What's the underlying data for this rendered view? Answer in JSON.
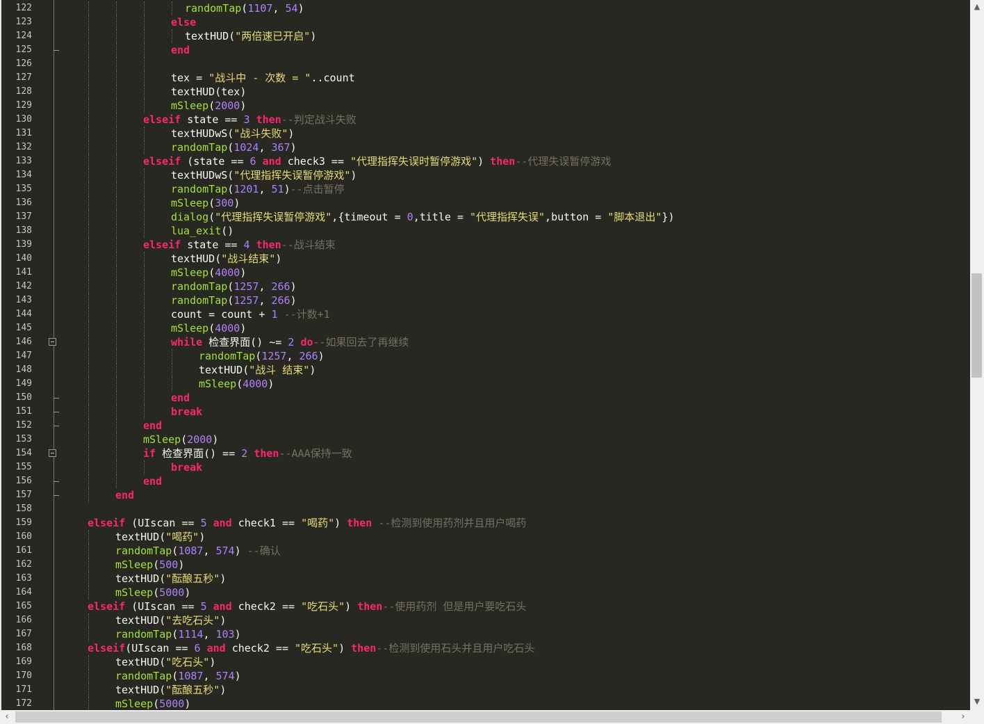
{
  "editor": {
    "first_line_number": 122,
    "lines": [
      [
        [
          9,
          "fn",
          "randomTap"
        ],
        [
          0,
          "op",
          "("
        ],
        [
          0,
          "num",
          "1107"
        ],
        [
          0,
          "op",
          ", "
        ],
        [
          0,
          "num",
          "54"
        ],
        [
          0,
          "op",
          ")"
        ]
      ],
      [
        [
          8,
          "kw",
          "else"
        ]
      ],
      [
        [
          9,
          "op",
          "textHUD("
        ],
        [
          0,
          "str",
          "\"两倍速已开启\""
        ],
        [
          0,
          "op",
          ")"
        ]
      ],
      [
        [
          8,
          "kw",
          "end"
        ]
      ],
      [],
      [
        [
          8,
          "op",
          "tex = "
        ],
        [
          0,
          "str",
          "\"战斗中 - 次数 = \""
        ],
        [
          0,
          "op",
          "..count"
        ]
      ],
      [
        [
          8,
          "op",
          "textHUD(tex)"
        ]
      ],
      [
        [
          8,
          "fn",
          "mSleep"
        ],
        [
          0,
          "op",
          "("
        ],
        [
          0,
          "num",
          "2000"
        ],
        [
          0,
          "op",
          ")"
        ]
      ],
      [
        [
          6,
          "kw",
          "elseif"
        ],
        [
          0,
          "op",
          " state == "
        ],
        [
          0,
          "num",
          "3"
        ],
        [
          0,
          "op",
          " "
        ],
        [
          0,
          "kw",
          "then"
        ],
        [
          0,
          "cm",
          "--判定战斗失败"
        ]
      ],
      [
        [
          8,
          "op",
          "textHUDwS("
        ],
        [
          0,
          "str",
          "\"战斗失败\""
        ],
        [
          0,
          "op",
          ")"
        ]
      ],
      [
        [
          8,
          "fn",
          "randomTap"
        ],
        [
          0,
          "op",
          "("
        ],
        [
          0,
          "num",
          "1024"
        ],
        [
          0,
          "op",
          ", "
        ],
        [
          0,
          "num",
          "367"
        ],
        [
          0,
          "op",
          ")"
        ]
      ],
      [
        [
          6,
          "kw",
          "elseif"
        ],
        [
          0,
          "op",
          " (state == "
        ],
        [
          0,
          "num",
          "6"
        ],
        [
          0,
          "op",
          " "
        ],
        [
          0,
          "kw",
          "and"
        ],
        [
          0,
          "op",
          " check3 == "
        ],
        [
          0,
          "str",
          "\"代理指挥失误时暂停游戏\""
        ],
        [
          0,
          "op",
          ") "
        ],
        [
          0,
          "kw",
          "then"
        ],
        [
          0,
          "cm",
          "--代理失误暂停游戏"
        ]
      ],
      [
        [
          8,
          "op",
          "textHUDwS("
        ],
        [
          0,
          "str",
          "\"代理指挥失误暂停游戏\""
        ],
        [
          0,
          "op",
          ")"
        ]
      ],
      [
        [
          8,
          "fn",
          "randomTap"
        ],
        [
          0,
          "op",
          "("
        ],
        [
          0,
          "num",
          "1201"
        ],
        [
          0,
          "op",
          ", "
        ],
        [
          0,
          "num",
          "51"
        ],
        [
          0,
          "op",
          ")"
        ],
        [
          0,
          "cm",
          "--点击暂停"
        ]
      ],
      [
        [
          8,
          "fn",
          "mSleep"
        ],
        [
          0,
          "op",
          "("
        ],
        [
          0,
          "num",
          "300"
        ],
        [
          0,
          "op",
          ")"
        ]
      ],
      [
        [
          8,
          "fn",
          "dialog"
        ],
        [
          0,
          "op",
          "("
        ],
        [
          0,
          "str",
          "\"代理指挥失误暂停游戏\""
        ],
        [
          0,
          "op",
          ",{timeout = "
        ],
        [
          0,
          "num",
          "0"
        ],
        [
          0,
          "op",
          ",title = "
        ],
        [
          0,
          "str",
          "\"代理指挥失误\""
        ],
        [
          0,
          "op",
          ",button = "
        ],
        [
          0,
          "str",
          "\"脚本退出\""
        ],
        [
          0,
          "op",
          "})"
        ]
      ],
      [
        [
          8,
          "fn",
          "lua_exit"
        ],
        [
          0,
          "op",
          "()"
        ]
      ],
      [
        [
          6,
          "kw",
          "elseif"
        ],
        [
          0,
          "op",
          " state == "
        ],
        [
          0,
          "num",
          "4"
        ],
        [
          0,
          "op",
          " "
        ],
        [
          0,
          "kw",
          "then"
        ],
        [
          0,
          "cm",
          "--战斗结束"
        ]
      ],
      [
        [
          8,
          "op",
          "textHUD("
        ],
        [
          0,
          "str",
          "\"战斗结束\""
        ],
        [
          0,
          "op",
          ")"
        ]
      ],
      [
        [
          8,
          "fn",
          "mSleep"
        ],
        [
          0,
          "op",
          "("
        ],
        [
          0,
          "num",
          "4000"
        ],
        [
          0,
          "op",
          ")"
        ]
      ],
      [
        [
          8,
          "fn",
          "randomTap"
        ],
        [
          0,
          "op",
          "("
        ],
        [
          0,
          "num",
          "1257"
        ],
        [
          0,
          "op",
          ", "
        ],
        [
          0,
          "num",
          "266"
        ],
        [
          0,
          "op",
          ")"
        ]
      ],
      [
        [
          8,
          "fn",
          "randomTap"
        ],
        [
          0,
          "op",
          "("
        ],
        [
          0,
          "num",
          "1257"
        ],
        [
          0,
          "op",
          ", "
        ],
        [
          0,
          "num",
          "266"
        ],
        [
          0,
          "op",
          ")"
        ]
      ],
      [
        [
          8,
          "op",
          "count = count + "
        ],
        [
          0,
          "num",
          "1"
        ],
        [
          0,
          "op",
          " "
        ],
        [
          0,
          "cm",
          "--计数+1"
        ]
      ],
      [
        [
          8,
          "fn",
          "mSleep"
        ],
        [
          0,
          "op",
          "("
        ],
        [
          0,
          "num",
          "4000"
        ],
        [
          0,
          "op",
          ")"
        ]
      ],
      [
        [
          8,
          "kw",
          "while"
        ],
        [
          0,
          "op",
          " 检查界面() ~= "
        ],
        [
          0,
          "num",
          "2"
        ],
        [
          0,
          "op",
          " "
        ],
        [
          0,
          "kw",
          "do"
        ],
        [
          0,
          "cm",
          "--如果回去了再继续"
        ]
      ],
      [
        [
          10,
          "fn",
          "randomTap"
        ],
        [
          0,
          "op",
          "("
        ],
        [
          0,
          "num",
          "1257"
        ],
        [
          0,
          "op",
          ", "
        ],
        [
          0,
          "num",
          "266"
        ],
        [
          0,
          "op",
          ")"
        ]
      ],
      [
        [
          10,
          "op",
          "textHUD("
        ],
        [
          0,
          "str",
          "\"战斗 结束\""
        ],
        [
          0,
          "op",
          ")"
        ]
      ],
      [
        [
          10,
          "fn",
          "mSleep"
        ],
        [
          0,
          "op",
          "("
        ],
        [
          0,
          "num",
          "4000"
        ],
        [
          0,
          "op",
          ")"
        ]
      ],
      [
        [
          8,
          "kw",
          "end"
        ]
      ],
      [
        [
          8,
          "kw",
          "break"
        ]
      ],
      [
        [
          6,
          "kw",
          "end"
        ]
      ],
      [
        [
          6,
          "fn",
          "mSleep"
        ],
        [
          0,
          "op",
          "("
        ],
        [
          0,
          "num",
          "2000"
        ],
        [
          0,
          "op",
          ")"
        ]
      ],
      [
        [
          6,
          "kw",
          "if"
        ],
        [
          0,
          "op",
          " 检查界面() == "
        ],
        [
          0,
          "num",
          "2"
        ],
        [
          0,
          "op",
          " "
        ],
        [
          0,
          "kw",
          "then"
        ],
        [
          0,
          "cm",
          "--AAA保持一致"
        ]
      ],
      [
        [
          8,
          "kw",
          "break"
        ]
      ],
      [
        [
          6,
          "kw",
          "end"
        ]
      ],
      [
        [
          4,
          "kw",
          "end"
        ]
      ],
      [],
      [
        [
          2,
          "kw",
          "elseif"
        ],
        [
          0,
          "op",
          " (UIscan == "
        ],
        [
          0,
          "num",
          "5"
        ],
        [
          0,
          "op",
          " "
        ],
        [
          0,
          "kw",
          "and"
        ],
        [
          0,
          "op",
          " check1 == "
        ],
        [
          0,
          "str",
          "\"喝药\""
        ],
        [
          0,
          "op",
          ") "
        ],
        [
          0,
          "kw",
          "then"
        ],
        [
          0,
          "op",
          " "
        ],
        [
          0,
          "cm",
          "--检测到使用药剂并且用户喝药"
        ]
      ],
      [
        [
          4,
          "op",
          "textHUD("
        ],
        [
          0,
          "str",
          "\"喝药\""
        ],
        [
          0,
          "op",
          ")"
        ]
      ],
      [
        [
          4,
          "fn",
          "randomTap"
        ],
        [
          0,
          "op",
          "("
        ],
        [
          0,
          "num",
          "1087"
        ],
        [
          0,
          "op",
          ", "
        ],
        [
          0,
          "num",
          "574"
        ],
        [
          0,
          "op",
          ") "
        ],
        [
          0,
          "cm",
          "--确认"
        ]
      ],
      [
        [
          4,
          "fn",
          "mSleep"
        ],
        [
          0,
          "op",
          "("
        ],
        [
          0,
          "num",
          "500"
        ],
        [
          0,
          "op",
          ")"
        ]
      ],
      [
        [
          4,
          "op",
          "textHUD("
        ],
        [
          0,
          "str",
          "\"酝酿五秒\""
        ],
        [
          0,
          "op",
          ")"
        ]
      ],
      [
        [
          4,
          "fn",
          "mSleep"
        ],
        [
          0,
          "op",
          "("
        ],
        [
          0,
          "num",
          "5000"
        ],
        [
          0,
          "op",
          ")"
        ]
      ],
      [
        [
          2,
          "kw",
          "elseif"
        ],
        [
          0,
          "op",
          " (UIscan == "
        ],
        [
          0,
          "num",
          "5"
        ],
        [
          0,
          "op",
          " "
        ],
        [
          0,
          "kw",
          "and"
        ],
        [
          0,
          "op",
          " check2 == "
        ],
        [
          0,
          "str",
          "\"吃石头\""
        ],
        [
          0,
          "op",
          ") "
        ],
        [
          0,
          "kw",
          "then"
        ],
        [
          0,
          "cm",
          "--使用药剂 但是用户要吃石头"
        ]
      ],
      [
        [
          4,
          "op",
          "textHUD("
        ],
        [
          0,
          "str",
          "\"去吃石头\""
        ],
        [
          0,
          "op",
          ")"
        ]
      ],
      [
        [
          4,
          "fn",
          "randomTap"
        ],
        [
          0,
          "op",
          "("
        ],
        [
          0,
          "num",
          "1114"
        ],
        [
          0,
          "op",
          ", "
        ],
        [
          0,
          "num",
          "103"
        ],
        [
          0,
          "op",
          ")"
        ]
      ],
      [
        [
          2,
          "kw",
          "elseif"
        ],
        [
          0,
          "op",
          "(UIscan == "
        ],
        [
          0,
          "num",
          "6"
        ],
        [
          0,
          "op",
          " "
        ],
        [
          0,
          "kw",
          "and"
        ],
        [
          0,
          "op",
          " check2 == "
        ],
        [
          0,
          "str",
          "\"吃石头\""
        ],
        [
          0,
          "op",
          ") "
        ],
        [
          0,
          "kw",
          "then"
        ],
        [
          0,
          "cm",
          "--检测到使用石头并且用户吃石头"
        ]
      ],
      [
        [
          4,
          "op",
          "textHUD("
        ],
        [
          0,
          "str",
          "\"吃石头\""
        ],
        [
          0,
          "op",
          ")"
        ]
      ],
      [
        [
          4,
          "fn",
          "randomTap"
        ],
        [
          0,
          "op",
          "("
        ],
        [
          0,
          "num",
          "1087"
        ],
        [
          0,
          "op",
          ", "
        ],
        [
          0,
          "num",
          "574"
        ],
        [
          0,
          "op",
          ")"
        ]
      ],
      [
        [
          4,
          "op",
          "textHUD("
        ],
        [
          0,
          "str",
          "\"酝酿五秒\""
        ],
        [
          0,
          "op",
          ")"
        ]
      ],
      [
        [
          4,
          "fn",
          "mSleep"
        ],
        [
          0,
          "op",
          "("
        ],
        [
          0,
          "num",
          "5000"
        ],
        [
          0,
          "op",
          ")"
        ]
      ]
    ],
    "fold_boxes": [
      146,
      154
    ],
    "fold_ends": [
      125,
      150,
      151,
      152,
      156,
      157
    ],
    "colors": {
      "background": "#272822",
      "keyword": "#f92672",
      "function": "#a6e22e",
      "number": "#ae81ff",
      "string": "#e6db74",
      "comment": "#75715e",
      "text": "#f8f8f2"
    }
  },
  "scrollbars": {
    "up_icon": "▲",
    "down_icon": "▼",
    "left_icon": "‹",
    "right_icon": "›",
    "vertical_position": 0.45,
    "horizontal_position": 0.0
  }
}
